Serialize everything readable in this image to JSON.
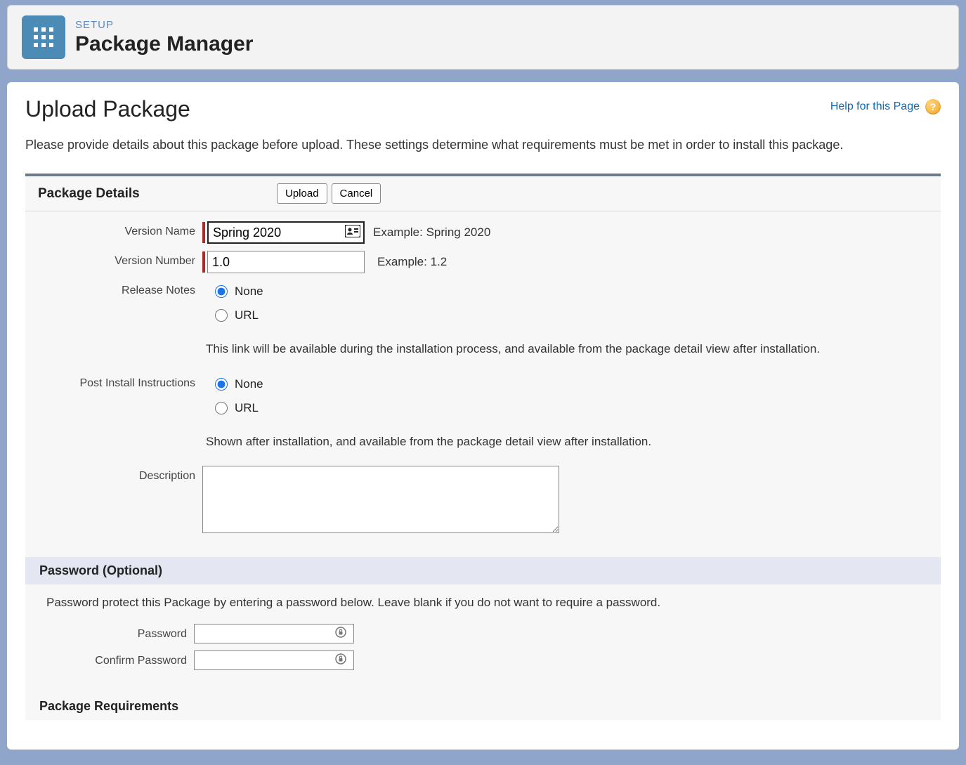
{
  "header": {
    "subtitle": "SETUP",
    "title": "Package Manager"
  },
  "page": {
    "title": "Upload Package",
    "help_link": "Help for this Page",
    "intro": "Please provide details about this package before upload. These settings determine what requirements must be met in order to install this package."
  },
  "details": {
    "title": "Package Details",
    "upload_label": "Upload",
    "cancel_label": "Cancel",
    "version_name_label": "Version Name",
    "version_name_value": "Spring 2020",
    "version_name_hint": "Example: Spring 2020",
    "version_number_label": "Version Number",
    "version_number_value": "1.0",
    "version_number_hint": "Example: 1.2",
    "release_notes_label": "Release Notes",
    "release_notes_options": {
      "none": "None",
      "url": "URL"
    },
    "release_notes_desc": "This link will be available during the installation process, and available from the package detail view after installation.",
    "post_install_label": "Post Install Instructions",
    "post_install_options": {
      "none": "None",
      "url": "URL"
    },
    "post_install_desc": "Shown after installation, and available from the package detail view after installation.",
    "description_label": "Description",
    "description_value": ""
  },
  "password_section": {
    "title": "Password (Optional)",
    "intro": "Password protect this Package by entering a password below. Leave blank if you do not want to require a password.",
    "password_label": "Password",
    "confirm_label": "Confirm Password"
  },
  "requirements_section": {
    "title": "Package Requirements"
  }
}
